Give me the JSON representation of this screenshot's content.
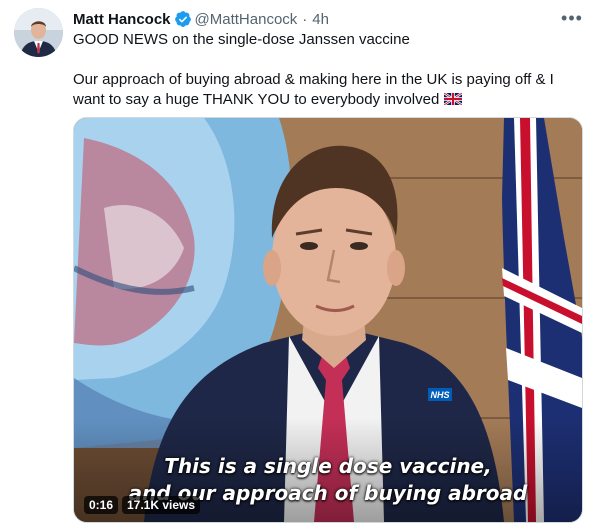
{
  "author": {
    "name": "Matt Hancock",
    "handle": "@MattHancock",
    "separator": "·",
    "time": "4h",
    "verified_icon": "verified-badge-icon",
    "avatar_icon": "avatar"
  },
  "more_icon": "more-options-icon",
  "more_label": "•••",
  "tweet": {
    "line1": "GOOD NEWS on the single-dose Janssen vaccine",
    "line2": "Our approach of buying abroad & making here in the UK is paying off & I want to say a huge THANK YOU to everybody involved",
    "flag_icon": "uk-flag-emoji-icon"
  },
  "video": {
    "subtitle_line1": "This is a single dose vaccine,",
    "subtitle_line2": "and our approach of buying abroad",
    "duration": "0:16",
    "views": "17.1K views",
    "badge_text": "NHS"
  },
  "colors": {
    "verified": "#1d9bf0",
    "text": "#0f1419",
    "muted": "#536471",
    "border": "#cfd9de"
  }
}
